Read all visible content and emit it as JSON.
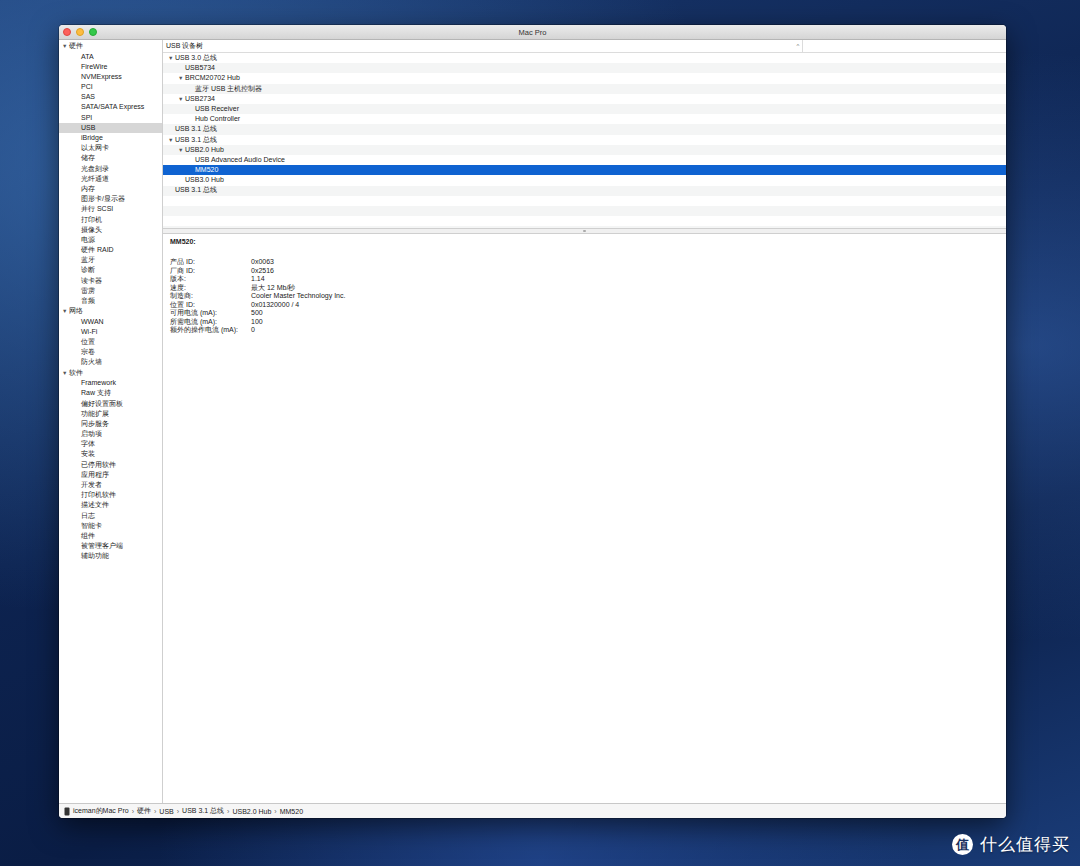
{
  "window": {
    "title": "Mac Pro"
  },
  "sidebar": {
    "sections": [
      {
        "label": "硬件",
        "toggle": "▼",
        "items": [
          {
            "label": "ATA",
            "selected": false
          },
          {
            "label": "FireWire",
            "selected": false
          },
          {
            "label": "NVMExpress",
            "selected": false
          },
          {
            "label": "PCI",
            "selected": false
          },
          {
            "label": "SAS",
            "selected": false
          },
          {
            "label": "SATA/SATA Express",
            "selected": false
          },
          {
            "label": "SPI",
            "selected": false
          },
          {
            "label": "USB",
            "selected": true
          },
          {
            "label": "iBridge",
            "selected": false
          },
          {
            "label": "以太网卡",
            "selected": false
          },
          {
            "label": "储存",
            "selected": false
          },
          {
            "label": "光盘刻录",
            "selected": false
          },
          {
            "label": "光纤通道",
            "selected": false
          },
          {
            "label": "内存",
            "selected": false
          },
          {
            "label": "图形卡/显示器",
            "selected": false
          },
          {
            "label": "并行 SCSI",
            "selected": false
          },
          {
            "label": "打印机",
            "selected": false
          },
          {
            "label": "摄像头",
            "selected": false
          },
          {
            "label": "电源",
            "selected": false
          },
          {
            "label": "硬件 RAID",
            "selected": false
          },
          {
            "label": "蓝牙",
            "selected": false
          },
          {
            "label": "诊断",
            "selected": false
          },
          {
            "label": "读卡器",
            "selected": false
          },
          {
            "label": "雷雳",
            "selected": false
          },
          {
            "label": "音频",
            "selected": false
          }
        ]
      },
      {
        "label": "网络",
        "toggle": "▼",
        "items": [
          {
            "label": "WWAN",
            "selected": false
          },
          {
            "label": "Wi-Fi",
            "selected": false
          },
          {
            "label": "位置",
            "selected": false
          },
          {
            "label": "宗卷",
            "selected": false
          },
          {
            "label": "防火墙",
            "selected": false
          }
        ]
      },
      {
        "label": "软件",
        "toggle": "▼",
        "items": [
          {
            "label": "Framework",
            "selected": false
          },
          {
            "label": "Raw 支持",
            "selected": false
          },
          {
            "label": "偏好设置面板",
            "selected": false
          },
          {
            "label": "功能扩展",
            "selected": false
          },
          {
            "label": "同步服务",
            "selected": false
          },
          {
            "label": "启动项",
            "selected": false
          },
          {
            "label": "字体",
            "selected": false
          },
          {
            "label": "安装",
            "selected": false
          },
          {
            "label": "已停用软件",
            "selected": false
          },
          {
            "label": "应用程序",
            "selected": false
          },
          {
            "label": "开发者",
            "selected": false
          },
          {
            "label": "打印机软件",
            "selected": false
          },
          {
            "label": "描述文件",
            "selected": false
          },
          {
            "label": "日志",
            "selected": false
          },
          {
            "label": "智能卡",
            "selected": false
          },
          {
            "label": "组件",
            "selected": false
          },
          {
            "label": "被管理客户端",
            "selected": false
          },
          {
            "label": "辅助功能",
            "selected": false
          }
        ]
      }
    ]
  },
  "tree": {
    "header": "USB 设备树",
    "sort_indicator": "^",
    "rows": [
      {
        "label": "USB 3.0 总线",
        "depth": 0,
        "toggle": "▼",
        "selected": false
      },
      {
        "label": "USB5734",
        "depth": 1,
        "toggle": "",
        "selected": false
      },
      {
        "label": "BRCM20702 Hub",
        "depth": 1,
        "toggle": "▼",
        "selected": false
      },
      {
        "label": "蓝牙 USB 主机控制器",
        "depth": 2,
        "toggle": "",
        "selected": false
      },
      {
        "label": "USB2734",
        "depth": 1,
        "toggle": "▼",
        "selected": false
      },
      {
        "label": "USB Receiver",
        "depth": 2,
        "toggle": "",
        "selected": false
      },
      {
        "label": "Hub Controller",
        "depth": 2,
        "toggle": "",
        "selected": false
      },
      {
        "label": "USB 3.1 总线",
        "depth": 0,
        "toggle": "",
        "selected": false
      },
      {
        "label": "USB 3.1 总线",
        "depth": 0,
        "toggle": "▼",
        "selected": false
      },
      {
        "label": "USB2.0 Hub",
        "depth": 1,
        "toggle": "▼",
        "selected": false
      },
      {
        "label": "USB Advanced Audio Device",
        "depth": 2,
        "toggle": "",
        "selected": false
      },
      {
        "label": "MM520",
        "depth": 2,
        "toggle": "",
        "selected": true
      },
      {
        "label": "USB3.0 Hub",
        "depth": 1,
        "toggle": "",
        "selected": false
      },
      {
        "label": "USB 3.1 总线",
        "depth": 0,
        "toggle": "",
        "selected": false
      }
    ]
  },
  "detail": {
    "title": "MM520:",
    "fields": [
      {
        "key": "产品 ID:",
        "value": "0x0063"
      },
      {
        "key": "厂商 ID:",
        "value": "0x2516"
      },
      {
        "key": "版本:",
        "value": "1.14"
      },
      {
        "key": "速度:",
        "value": "最大 12 Mb/秒"
      },
      {
        "key": "制造商:",
        "value": "Cooler Master Technology Inc."
      },
      {
        "key": "位置 ID:",
        "value": "0x01320000 / 4"
      },
      {
        "key": "可用电流 (mA):",
        "value": "500"
      },
      {
        "key": "所需电流 (mA):",
        "value": "100"
      },
      {
        "key": "额外的操作电流 (mA):",
        "value": "0"
      }
    ]
  },
  "status_bar": {
    "separator": "›",
    "crumbs": [
      "iceman的Mac Pro",
      "硬件",
      "USB",
      "USB 3.1 总线",
      "USB2.0 Hub",
      "MM520"
    ]
  },
  "watermark": {
    "icon_char": "值",
    "text": "什么值得买"
  }
}
